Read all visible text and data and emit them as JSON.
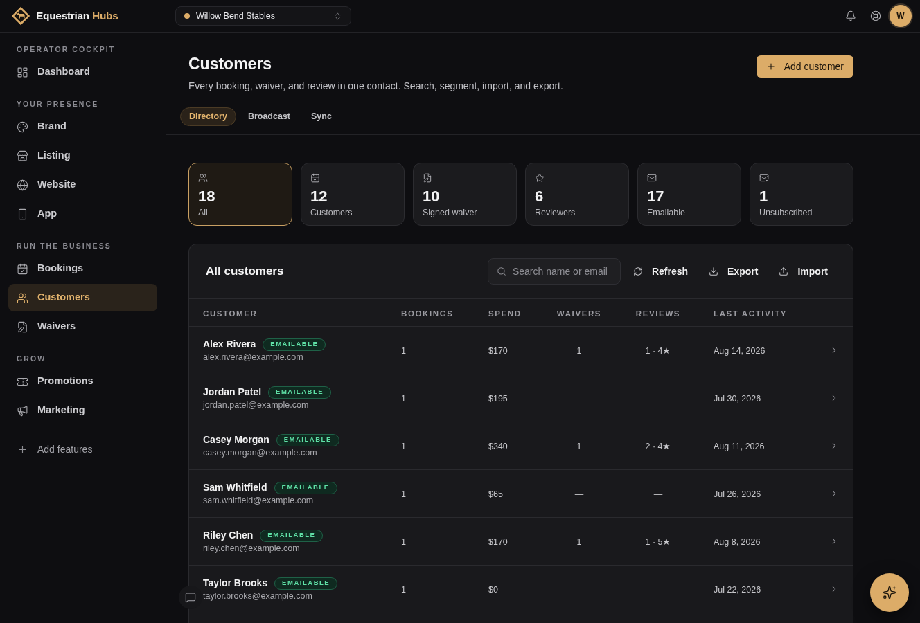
{
  "brand": {
    "name": "Equestrian",
    "accent": "Hubs"
  },
  "location_select": {
    "value": "Willow Bend Stables"
  },
  "avatar": {
    "initial": "W"
  },
  "sidebar": {
    "sections": [
      {
        "label": "OPERATOR COCKPIT",
        "items": [
          {
            "label": "Dashboard",
            "selected": false
          }
        ]
      },
      {
        "label": "YOUR PRESENCE",
        "items": [
          {
            "label": "Brand",
            "selected": false
          },
          {
            "label": "Listing",
            "selected": false
          },
          {
            "label": "Website",
            "selected": false
          },
          {
            "label": "App",
            "selected": false
          }
        ]
      },
      {
        "label": "RUN THE BUSINESS",
        "items": [
          {
            "label": "Bookings",
            "selected": false
          },
          {
            "label": "Customers",
            "selected": true
          },
          {
            "label": "Waivers",
            "selected": false
          }
        ]
      },
      {
        "label": "GROW",
        "items": [
          {
            "label": "Promotions",
            "selected": false
          },
          {
            "label": "Marketing",
            "selected": false
          }
        ]
      }
    ],
    "add_features": "Add features"
  },
  "page": {
    "title": "Customers",
    "subtitle": "Every booking, waiver, and review in one contact. Search, segment, import, and export.",
    "primary_action": "Add customer"
  },
  "tabs": [
    {
      "label": "Directory",
      "selected": true
    },
    {
      "label": "Broadcast",
      "selected": false
    },
    {
      "label": "Sync",
      "selected": false
    }
  ],
  "stats": [
    {
      "value": "18",
      "label": "All",
      "selected": true
    },
    {
      "value": "12",
      "label": "Customers",
      "selected": false
    },
    {
      "value": "10",
      "label": "Signed waiver",
      "selected": false
    },
    {
      "value": "6",
      "label": "Reviewers",
      "selected": false
    },
    {
      "value": "17",
      "label": "Emailable",
      "selected": false
    },
    {
      "value": "1",
      "label": "Unsubscribed",
      "selected": false
    }
  ],
  "customers_table": {
    "title": "All customers",
    "search": {
      "placeholder": "Search name or email"
    },
    "actions": [
      "Refresh",
      "Export",
      "Import"
    ],
    "columns": [
      "CUSTOMER",
      "BOOKINGS",
      "SPEND",
      "WAIVERS",
      "REVIEWS",
      "LAST ACTIVITY"
    ],
    "rows": [
      {
        "name": "Alex Rivera",
        "badge": "EMAILABLE",
        "email": "alex.rivera@example.com",
        "bookings": "1",
        "spend": "$170",
        "waivers": "1",
        "reviews": "1 · 4★",
        "last_activity": "Aug 14, 2026"
      },
      {
        "name": "Jordan Patel",
        "badge": "EMAILABLE",
        "email": "jordan.patel@example.com",
        "bookings": "1",
        "spend": "$195",
        "waivers": "—",
        "reviews": "—",
        "last_activity": "Jul 30, 2026"
      },
      {
        "name": "Casey Morgan",
        "badge": "EMAILABLE",
        "email": "casey.morgan@example.com",
        "bookings": "1",
        "spend": "$340",
        "waivers": "1",
        "reviews": "2 · 4★",
        "last_activity": "Aug 11, 2026"
      },
      {
        "name": "Sam Whitfield",
        "badge": "EMAILABLE",
        "email": "sam.whitfield@example.com",
        "bookings": "1",
        "spend": "$65",
        "waivers": "—",
        "reviews": "—",
        "last_activity": "Jul 26, 2026"
      },
      {
        "name": "Riley Chen",
        "badge": "EMAILABLE",
        "email": "riley.chen@example.com",
        "bookings": "1",
        "spend": "$170",
        "waivers": "1",
        "reviews": "1 · 5★",
        "last_activity": "Aug 8, 2026"
      },
      {
        "name": "Taylor Brooks",
        "badge": "EMAILABLE",
        "email": "taylor.brooks@example.com",
        "bookings": "1",
        "spend": "$0",
        "waivers": "—",
        "reviews": "—",
        "last_activity": "Jul 22, 2026"
      }
    ]
  }
}
